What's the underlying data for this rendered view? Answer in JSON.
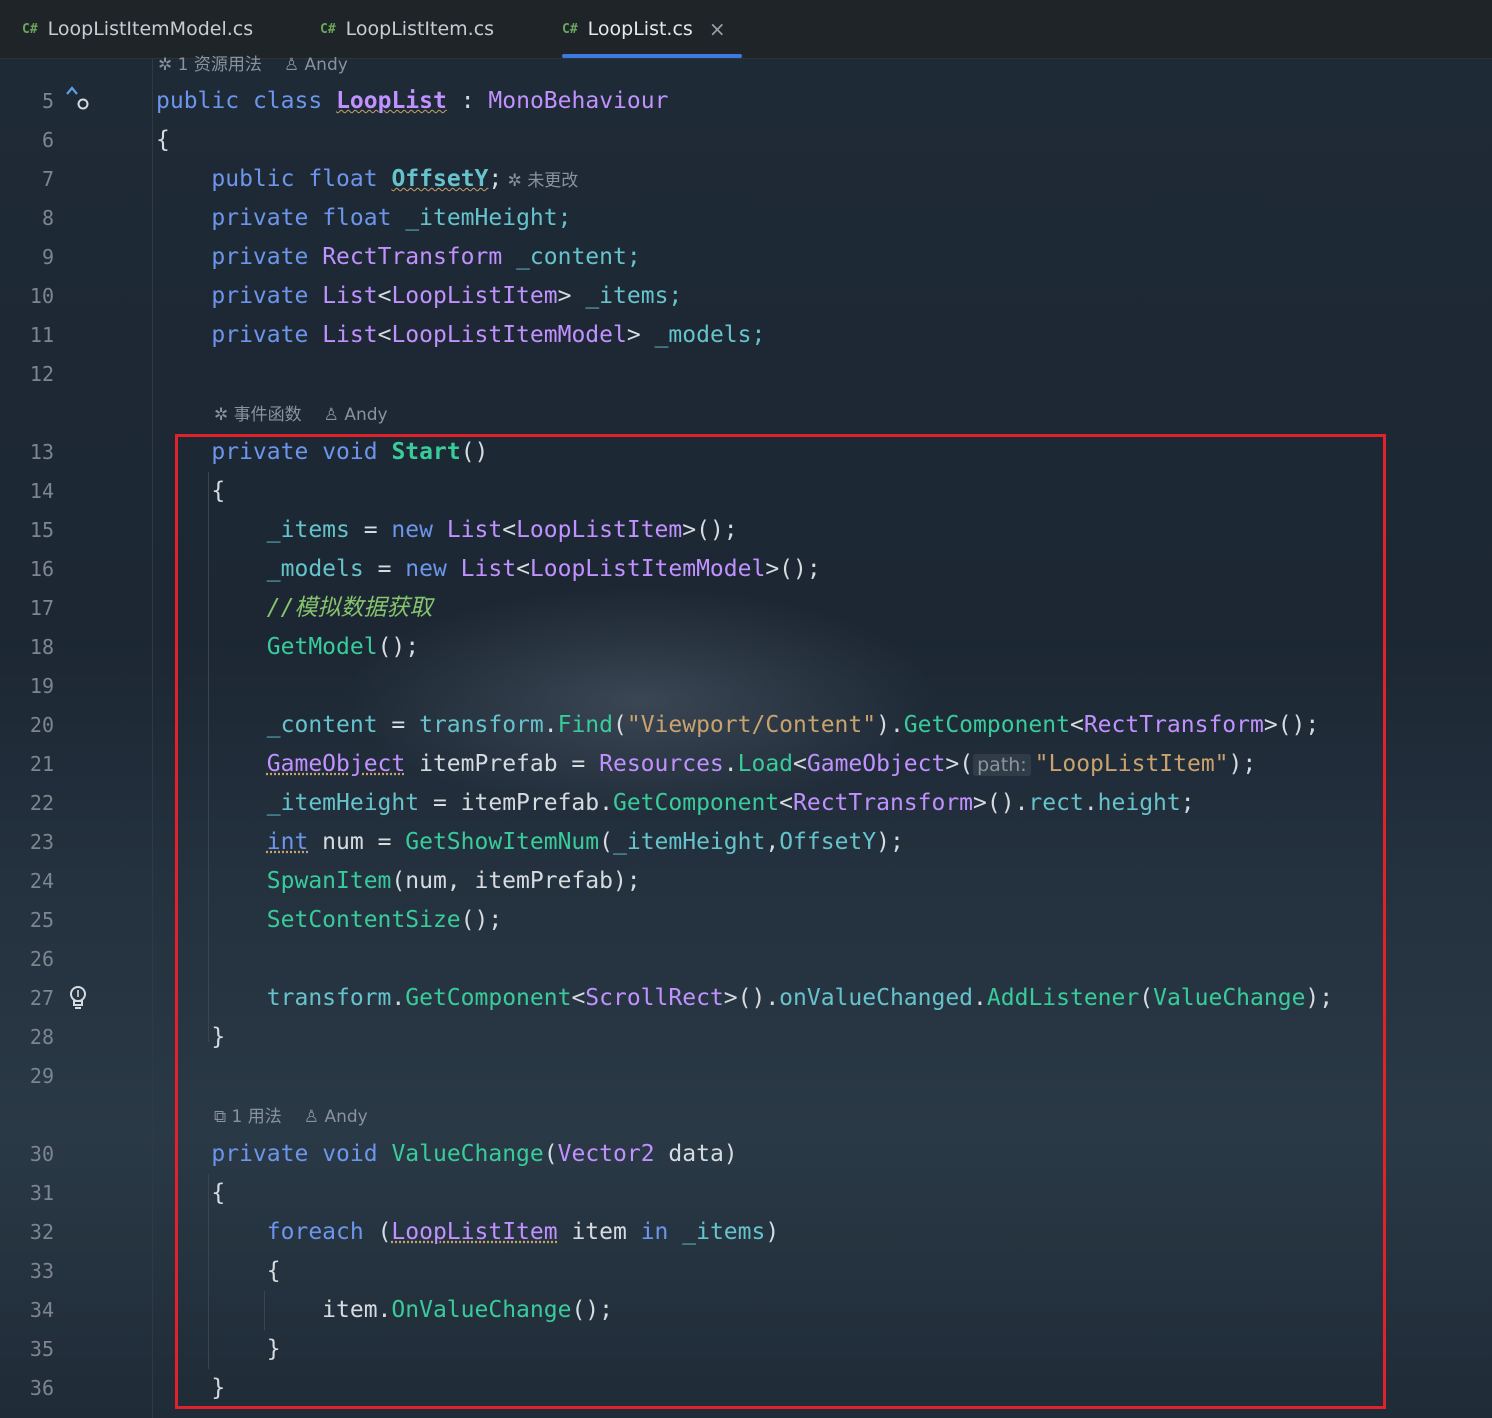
{
  "tabs": [
    {
      "badge": "C#",
      "label": "LoopListItemModel.cs"
    },
    {
      "badge": "C#",
      "label": "LoopListItem.cs"
    },
    {
      "badge": "C#",
      "label": "LoopList.cs",
      "close": "×"
    }
  ],
  "hints": {
    "class_usage": "1 资源用法",
    "class_author": "Andy",
    "offset_status": "未更改",
    "start_kind": "事件函数",
    "start_author": "Andy",
    "value_usage": "1 用法",
    "value_author": "Andy"
  },
  "line_numbers": [
    "5",
    "6",
    "7",
    "8",
    "9",
    "10",
    "11",
    "12",
    "13",
    "14",
    "15",
    "16",
    "17",
    "18",
    "19",
    "20",
    "21",
    "22",
    "23",
    "24",
    "25",
    "26",
    "27",
    "28",
    "29",
    "30",
    "31",
    "32",
    "33",
    "34",
    "35",
    "36"
  ],
  "inlay_path": "path:",
  "code": {
    "l5": [
      "public",
      "class",
      "LoopList",
      ":",
      "MonoBehaviour"
    ],
    "l6": [
      "{"
    ],
    "l7": [
      "public",
      "float",
      "OffsetY",
      ";"
    ],
    "l8": [
      "private",
      "float",
      "_itemHeight;"
    ],
    "l9": [
      "private",
      "RectTransform",
      "_content;"
    ],
    "l10": [
      "private",
      "List",
      "<",
      "LoopListItem",
      ">",
      "_items;"
    ],
    "l11": [
      "private",
      "List",
      "<",
      "LoopListItemModel",
      ">",
      "_models;"
    ],
    "l13": [
      "private",
      "void",
      "Start",
      "()"
    ],
    "l14": [
      "{"
    ],
    "l15": [
      "_items",
      " = ",
      "new",
      "List",
      "<",
      "LoopListItem",
      ">();"
    ],
    "l16": [
      "_models",
      " = ",
      "new",
      "List",
      "<",
      "LoopListItemModel",
      ">();"
    ],
    "l17": [
      "//模拟数据获取"
    ],
    "l18": [
      "GetModel",
      "();"
    ],
    "l20": [
      "_content",
      " = ",
      "transform",
      ".",
      "Find",
      "(",
      "\"Viewport/Content\"",
      ").",
      "GetComponent",
      "<",
      "RectTransform",
      ">();"
    ],
    "l21": [
      "GameObject",
      " itemPrefab = ",
      "Resources",
      ".",
      "Load",
      "<",
      "GameObject",
      ">(",
      "\"LoopListItem\"",
      ");"
    ],
    "l22": [
      "_itemHeight",
      " = itemPrefab.",
      "GetComponent",
      "<",
      "RectTransform",
      ">().",
      "rect",
      ".",
      "height",
      ";"
    ],
    "l23": [
      "int",
      " num = ",
      "GetShowItemNum",
      "(",
      "_itemHeight",
      ",",
      "OffsetY",
      ");"
    ],
    "l24": [
      "SpwanItem",
      "(num, itemPrefab);"
    ],
    "l25": [
      "SetContentSize",
      "();"
    ],
    "l27": [
      "transform",
      ".",
      "GetComponent",
      "<",
      "ScrollRect",
      ">().",
      "onValueChanged",
      ".",
      "AddListener",
      "(",
      "ValueChange",
      ");"
    ],
    "l28": [
      "}"
    ],
    "l30": [
      "private",
      "void",
      "ValueChange",
      "(",
      "Vector2",
      " data)"
    ],
    "l31": [
      "{"
    ],
    "l32": [
      "foreach",
      " (",
      "LoopListItem",
      " item ",
      "in",
      " ",
      "_items",
      ")"
    ],
    "l33": [
      "{"
    ],
    "l34": [
      "item.",
      "OnValueChange",
      "();"
    ],
    "l35": [
      "}"
    ],
    "l36": [
      "}"
    ]
  }
}
